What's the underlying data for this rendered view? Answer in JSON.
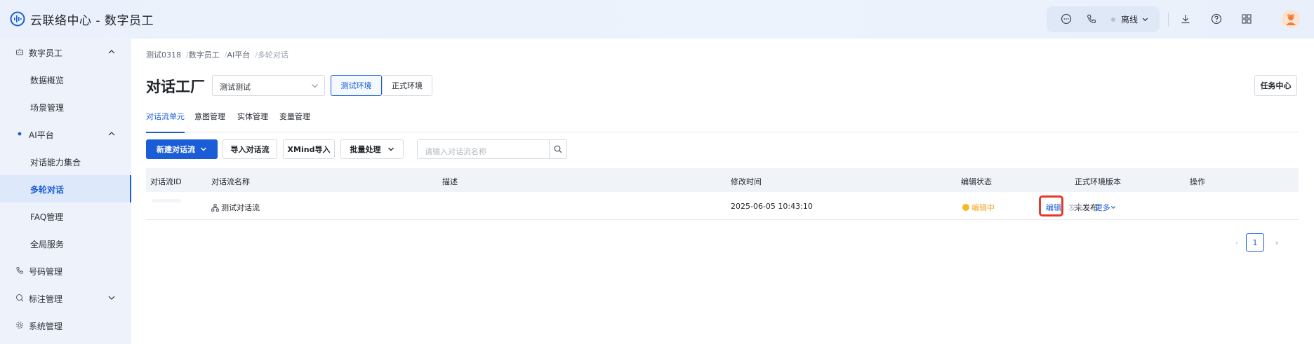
{
  "header": {
    "app_title": "云联络中心 - 数字员工",
    "status_label": "离线",
    "icons": [
      "chat-bubble-icon",
      "phone-icon",
      "download-icon",
      "help-icon",
      "apps-grid-icon"
    ]
  },
  "sidebar": {
    "items": [
      {
        "label": "数字员工",
        "type": "group",
        "expanded": true,
        "icon": "robot-icon"
      },
      {
        "label": "数据概览",
        "type": "sub"
      },
      {
        "label": "场景管理",
        "type": "sub"
      },
      {
        "label": "AI平台",
        "type": "group",
        "expanded": true,
        "icon": "dot-icon"
      },
      {
        "label": "对话能力集合",
        "type": "sub"
      },
      {
        "label": "多轮对话",
        "type": "sub",
        "active": true
      },
      {
        "label": "FAQ管理",
        "type": "sub"
      },
      {
        "label": "全局服务",
        "type": "sub"
      },
      {
        "label": "号码管理",
        "type": "group",
        "icon": "phone-icon"
      },
      {
        "label": "标注管理",
        "type": "group",
        "expanded": false,
        "icon": "tag-icon"
      },
      {
        "label": "系统管理",
        "type": "group",
        "icon": "settings-icon"
      }
    ]
  },
  "breadcrumb": [
    "测试0318",
    "数字员工",
    "AI平台",
    "多轮对话"
  ],
  "page": {
    "title": "对话工厂",
    "select_value": "测试测试",
    "env_test": "测试环境",
    "env_prod": "正式环境",
    "task_center": "任务中心"
  },
  "tabs": [
    "对话流单元",
    "意图管理",
    "实体管理",
    "变量管理"
  ],
  "toolbar": {
    "new_flow": "新建对话流",
    "import_flow": "导入对话流",
    "xmind_import": "XMind导入",
    "batch": "批量处理",
    "search_placeholder": "请输入对话流名称"
  },
  "table": {
    "columns": [
      "对话流ID",
      "对话流名称",
      "描述",
      "修改时间",
      "编辑状态",
      "正式环境版本",
      "操作"
    ],
    "rows": [
      {
        "id": "",
        "name": "测试对话流",
        "description": "",
        "modified": "2025-06-05 10:43:10",
        "status": "编辑中",
        "prod_version": "未发布",
        "ops": {
          "edit": "编辑",
          "publish": "发布",
          "more": "更多"
        }
      }
    ]
  },
  "pagination": {
    "current": "1",
    "prev": "‹",
    "next": "›"
  },
  "colors": {
    "primary": "#1a5dd6",
    "status_editing": "#f5a623",
    "highlight": "#e23a2c"
  }
}
